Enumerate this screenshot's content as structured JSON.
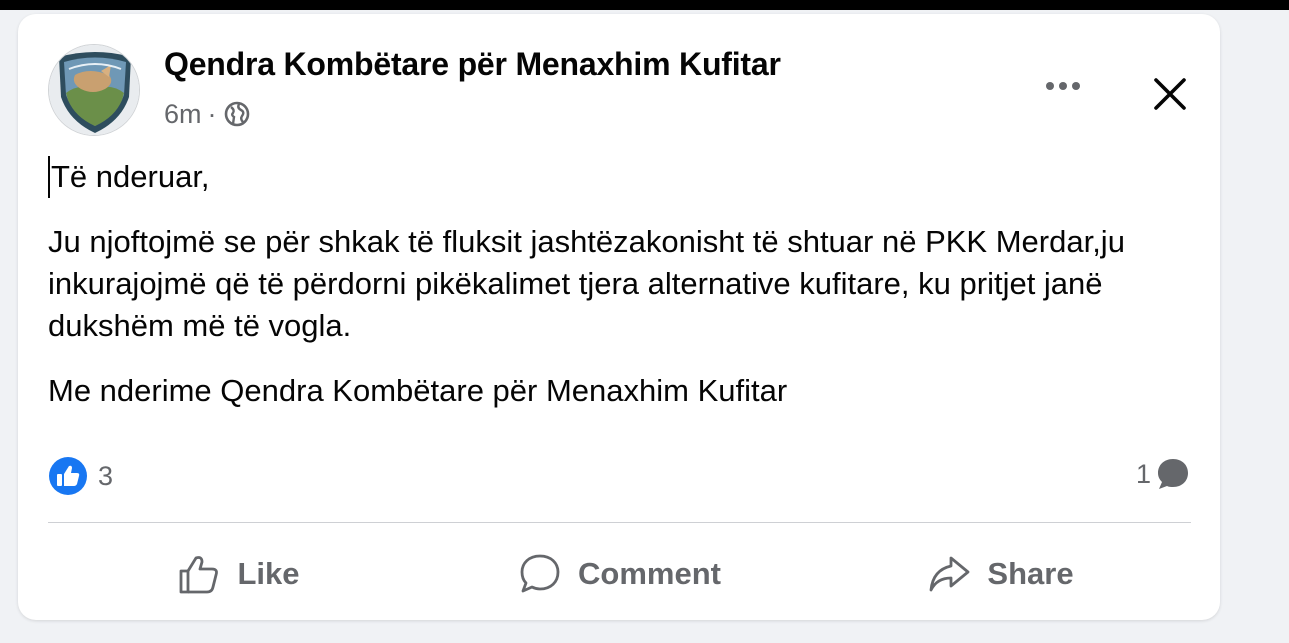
{
  "post": {
    "author": "Qendra Kombëtare për Menaxhim Kufitar",
    "time": "6m",
    "separator": "·",
    "paragraphs": {
      "greeting": "Të nderuar,",
      "message": "Ju njoftojmë se për shkak të fluksit jashtëzakonisht të shtuar në PKK Merdar,ju inkurajojmë që të përdorni pikëkalimet tjera alternative kufitare, ku pritjet janë dukshëm më të vogla.",
      "signoff": "Me nderime Qendra Kombëtare për Menaxhim Kufitar"
    },
    "reactions_count": "3",
    "comments_count": "1"
  },
  "actions": {
    "like": "Like",
    "comment": "Comment",
    "share": "Share"
  },
  "icons": {
    "avatar": "shield-logo",
    "audience": "globe-icon",
    "more": "more-options-icon",
    "close": "close-icon",
    "reaction": "like-reaction-icon",
    "comment_indicator": "comment-bubble-icon"
  },
  "colors": {
    "accent": "#1877f2",
    "secondary_text": "#65676b",
    "background": "#f0f2f5"
  }
}
